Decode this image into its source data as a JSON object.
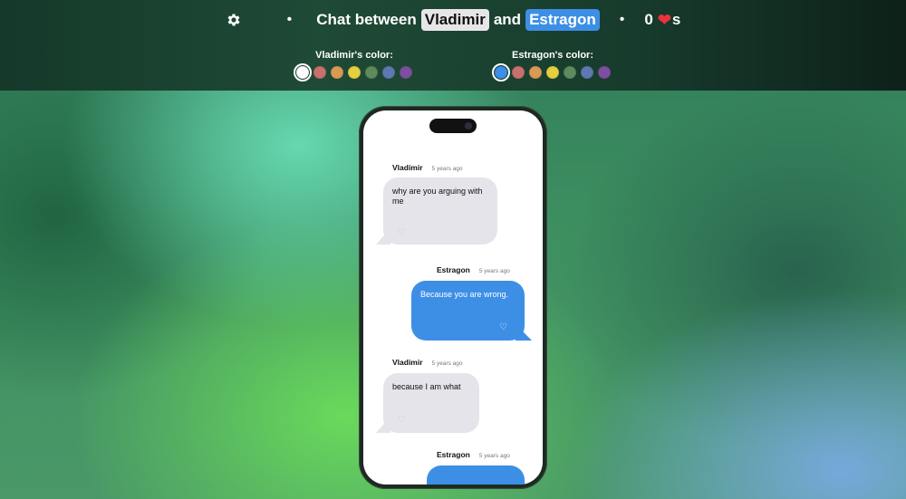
{
  "header": {
    "title_prefix": "Chat between",
    "name1": "Vladimir",
    "conjunction": "and",
    "name2": "Estragon",
    "separator": "•",
    "hearts_count": "0",
    "hearts_suffix": "s",
    "settings_icon": "gear-icon",
    "theme_icon": "moon-icon"
  },
  "colors": {
    "vladimir_label": "Vladimir's color:",
    "estragon_label": "Estragon's color:",
    "palette": [
      "#ffffff",
      "#c9706f",
      "#d99a54",
      "#e4cf3f",
      "#5e8a5e",
      "#5f78b2",
      "#7d4f9e"
    ],
    "vladimir_selected": 0,
    "estragon_palette": [
      "#3d8fe6",
      "#c9706f",
      "#d99a54",
      "#e4cf3f",
      "#5e8a5e",
      "#5f78b2",
      "#7d4f9e"
    ],
    "estragon_selected": 0
  },
  "messages": [
    {
      "sender": "Vladimir",
      "time": "5 years ago",
      "text": "why are you arguing with me",
      "side": "in"
    },
    {
      "sender": "Estragon",
      "time": "5 years ago",
      "text": "Because you are wrong.",
      "side": "out"
    },
    {
      "sender": "Vladimir",
      "time": "5 years ago",
      "text": "because I am what",
      "side": "in"
    },
    {
      "sender": "Estragon",
      "time": "5 years ago",
      "text": "",
      "side": "out"
    }
  ]
}
